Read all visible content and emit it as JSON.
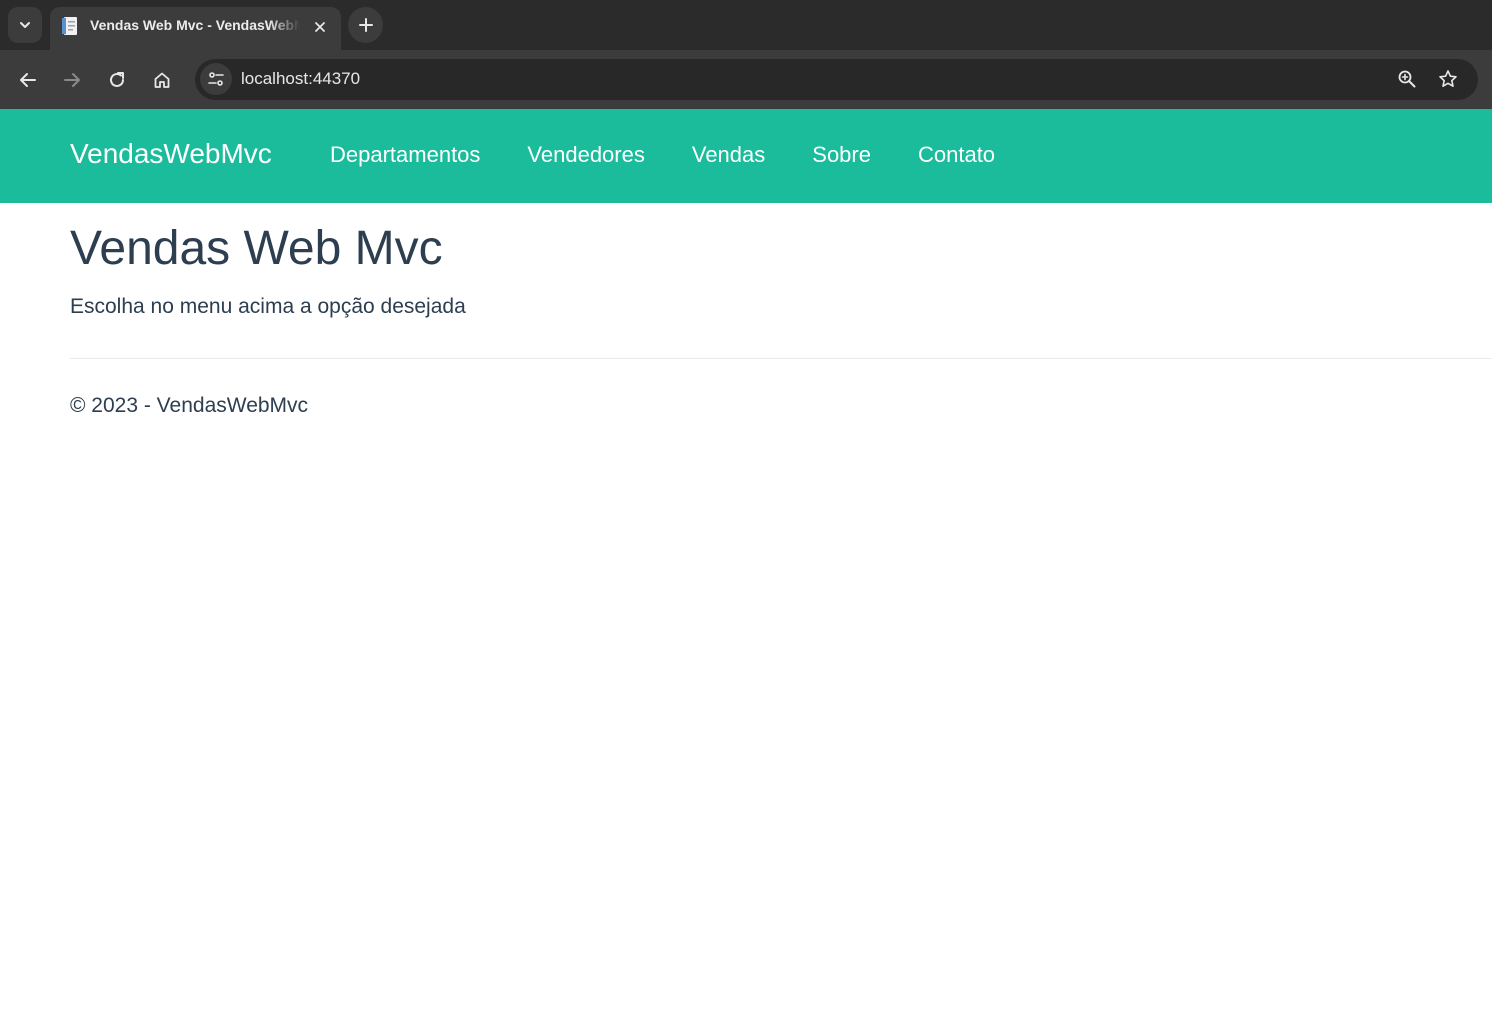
{
  "browser": {
    "tab": {
      "title": "Vendas Web Mvc - VendasWebMvc"
    },
    "address_bar": {
      "url": "localhost:44370"
    }
  },
  "colors": {
    "navbar": "#1abc9c",
    "text": "#2c3e50",
    "chrome_dark": "#2b2b2b",
    "chrome_toolbar": "#3c3c3c"
  },
  "navbar": {
    "brand": "VendasWebMvc",
    "links": [
      "Departamentos",
      "Vendedores",
      "Vendas",
      "Sobre",
      "Contato"
    ]
  },
  "main": {
    "title": "Vendas Web Mvc",
    "lead": "Escolha no menu acima a opção desejada"
  },
  "footer": {
    "text": "© 2023 - VendasWebMvc"
  }
}
